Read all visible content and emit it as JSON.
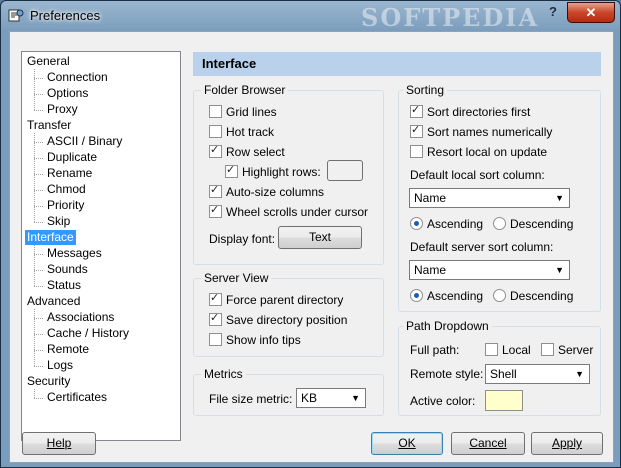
{
  "window": {
    "title": "Preferences",
    "watermark": "SOFTPEDIA",
    "help_glyph": "?",
    "close_glyph": "✕"
  },
  "tree": [
    {
      "label": "General",
      "level": 0
    },
    {
      "label": "Connection",
      "level": 1
    },
    {
      "label": "Options",
      "level": 1
    },
    {
      "label": "Proxy",
      "level": 1
    },
    {
      "label": "Transfer",
      "level": 0
    },
    {
      "label": "ASCII / Binary",
      "level": 1
    },
    {
      "label": "Duplicate",
      "level": 1
    },
    {
      "label": "Rename",
      "level": 1
    },
    {
      "label": "Chmod",
      "level": 1
    },
    {
      "label": "Priority",
      "level": 1
    },
    {
      "label": "Skip",
      "level": 1
    },
    {
      "label": "Interface",
      "level": 0,
      "selected": true
    },
    {
      "label": "Messages",
      "level": 1
    },
    {
      "label": "Sounds",
      "level": 1
    },
    {
      "label": "Status",
      "level": 1
    },
    {
      "label": "Advanced",
      "level": 0
    },
    {
      "label": "Associations",
      "level": 1
    },
    {
      "label": "Cache / History",
      "level": 1
    },
    {
      "label": "Remote",
      "level": 1
    },
    {
      "label": "Logs",
      "level": 1
    },
    {
      "label": "Security",
      "level": 0
    },
    {
      "label": "Certificates",
      "level": 1
    }
  ],
  "section_title": "Interface",
  "folder_browser": {
    "label": "Folder Browser",
    "grid_lines": {
      "label": "Grid lines",
      "checked": false
    },
    "hot_track": {
      "label": "Hot track",
      "checked": false
    },
    "row_select": {
      "label": "Row select",
      "checked": true
    },
    "highlight_rows": {
      "label": "Highlight rows:",
      "checked": true
    },
    "auto_size": {
      "label": "Auto-size columns",
      "checked": true
    },
    "wheel_scrolls": {
      "label": "Wheel scrolls under cursor",
      "checked": true
    },
    "display_font_label": "Display font:",
    "display_font_button": "Text",
    "highlight_color": "#f0f0f0"
  },
  "server_view": {
    "label": "Server View",
    "force_parent": {
      "label": "Force parent directory",
      "checked": true
    },
    "save_position": {
      "label": "Save directory position",
      "checked": true
    },
    "show_info_tips": {
      "label": "Show info tips",
      "checked": false
    }
  },
  "metrics": {
    "label": "Metrics",
    "file_size_label": "File size metric:",
    "file_size_value": "KB"
  },
  "sorting": {
    "label": "Sorting",
    "sort_dirs_first": {
      "label": "Sort directories first",
      "checked": true
    },
    "sort_numerically": {
      "label": "Sort names numerically",
      "checked": true
    },
    "resort_local": {
      "label": "Resort local on update",
      "checked": false
    },
    "local_label": "Default local sort column:",
    "local_value": "Name",
    "local_ascending": {
      "label": "Ascending",
      "selected": true
    },
    "local_descending": {
      "label": "Descending",
      "selected": false
    },
    "server_label": "Default server sort column:",
    "server_value": "Name",
    "server_ascending": {
      "label": "Ascending",
      "selected": true
    },
    "server_descending": {
      "label": "Descending",
      "selected": false
    }
  },
  "path_dropdown": {
    "label": "Path Dropdown",
    "full_path_label": "Full path:",
    "local": {
      "label": "Local",
      "checked": false
    },
    "server": {
      "label": "Server",
      "checked": false
    },
    "remote_style_label": "Remote style:",
    "remote_style_value": "Shell",
    "active_color_label": "Active color:",
    "active_color": "#ffffcc"
  },
  "buttons": {
    "help": "Help",
    "ok": "OK",
    "cancel": "Cancel",
    "apply": "Apply"
  },
  "colors": {
    "selection": "#3399ff",
    "header_bg": "#b9d1ea",
    "radio_dot": "#1d5db8"
  }
}
